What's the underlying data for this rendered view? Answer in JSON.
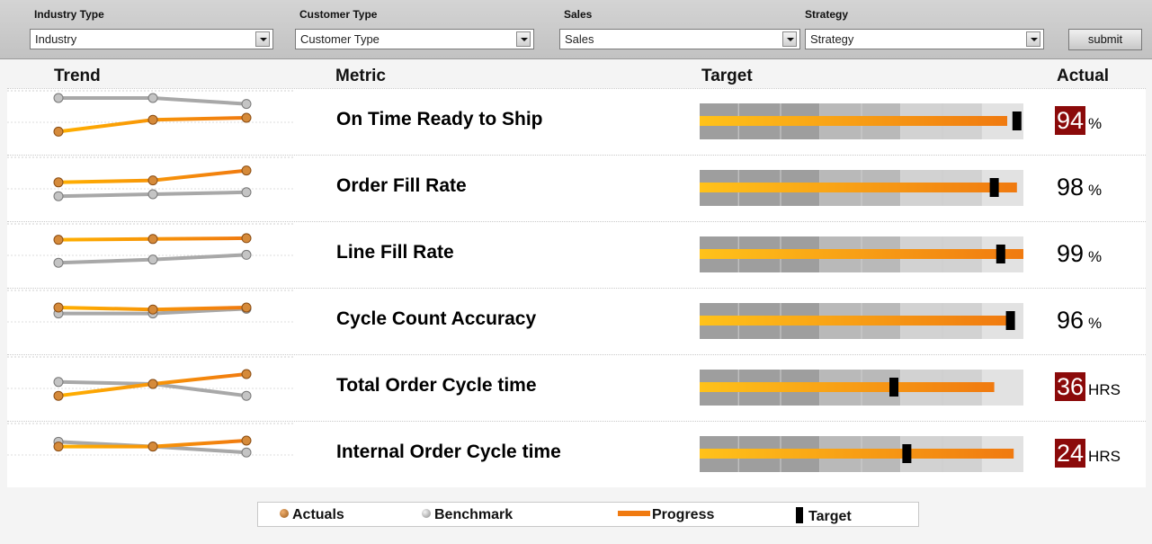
{
  "filters": {
    "industry_label": "Industry Type",
    "industry_value": "Industry",
    "customer_label": "Customer Type",
    "customer_value": "Customer Type",
    "sales_label": "Sales",
    "sales_value": "Sales",
    "strategy_label": "Strategy",
    "strategy_value": "Strategy",
    "submit_label": "submit"
  },
  "headers": {
    "trend": "Trend",
    "metric": "Metric",
    "target": "Target",
    "actual": "Actual"
  },
  "legend": {
    "actuals": "Actuals",
    "benchmark": "Benchmark",
    "progress": "Progress",
    "target": "Target"
  },
  "colors": {
    "actual_line": "#f07a10",
    "benchmark_line": "#a8a8a8",
    "progress": "#f07a10",
    "target_marker": "#000000",
    "alert": "#8b0a0a"
  },
  "chart_data": {
    "type": "bullet",
    "bullet_scale": [
      0,
      100
    ],
    "bands": [
      37,
      62,
      87,
      100
    ],
    "rows": [
      {
        "metric": "On Time Ready to Ship",
        "actual": "94",
        "unit": "%",
        "alert": true,
        "progress": 95,
        "target": 98,
        "trend_actual": [
          0.15,
          0.45,
          0.5
        ],
        "trend_benchmark": [
          1.0,
          1.0,
          0.85
        ]
      },
      {
        "metric": "Order Fill Rate",
        "actual": "98",
        "unit": "%",
        "alert": false,
        "progress": 98,
        "target": 91,
        "trend_actual": [
          0.55,
          0.6,
          0.85
        ],
        "trend_benchmark": [
          0.2,
          0.25,
          0.3
        ]
      },
      {
        "metric": "Line Fill Rate",
        "actual": "99",
        "unit": "%",
        "alert": false,
        "progress": 100,
        "target": 93,
        "trend_actual": [
          0.78,
          0.8,
          0.82
        ],
        "trend_benchmark": [
          0.2,
          0.28,
          0.4
        ]
      },
      {
        "metric": "Cycle Count Accuracy",
        "actual": "96",
        "unit": "%",
        "alert": false,
        "progress": 96,
        "target": 96,
        "trend_actual": [
          0.75,
          0.7,
          0.75
        ],
        "trend_benchmark": [
          0.6,
          0.6,
          0.72
        ]
      },
      {
        "metric": "Total Order Cycle time",
        "actual": "36",
        "unit": "HRS",
        "alert": true,
        "progress": 91,
        "target": 60,
        "trend_actual": [
          0.2,
          0.5,
          0.75
        ],
        "trend_benchmark": [
          0.55,
          0.5,
          0.2
        ]
      },
      {
        "metric": "Internal Order Cycle time",
        "actual": "24",
        "unit": "HRS",
        "alert": true,
        "progress": 97,
        "target": 64,
        "trend_actual": [
          0.6,
          0.6,
          0.75
        ],
        "trend_benchmark": [
          0.72,
          0.6,
          0.45
        ]
      }
    ]
  }
}
